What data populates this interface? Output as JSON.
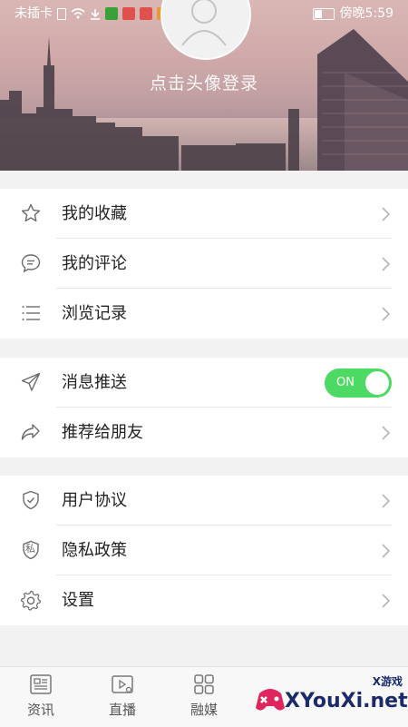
{
  "status": {
    "carrier": "未插卡",
    "time": "傍晚5:59"
  },
  "profile": {
    "login_prompt": "点击头像登录"
  },
  "menu": {
    "group1": [
      {
        "label": "我的收藏",
        "icon": "star-icon"
      },
      {
        "label": "我的评论",
        "icon": "comment-icon"
      },
      {
        "label": "浏览记录",
        "icon": "list-icon"
      }
    ],
    "group2": [
      {
        "label": "消息推送",
        "icon": "send-icon",
        "toggle": "ON"
      },
      {
        "label": "推荐给朋友",
        "icon": "share-icon"
      }
    ],
    "group3": [
      {
        "label": "用户协议",
        "icon": "shield-check-icon"
      },
      {
        "label": "隐私政策",
        "icon": "privacy-shield-icon",
        "icon_text": "私"
      },
      {
        "label": "设置",
        "icon": "gear-icon"
      }
    ]
  },
  "bottom_nav": [
    {
      "label": "资讯",
      "icon": "news-icon"
    },
    {
      "label": "直播",
      "icon": "live-icon"
    },
    {
      "label": "融媒",
      "icon": "grid-icon"
    }
  ],
  "watermark": {
    "brand": "XYouXi.net",
    "small": "X游戏"
  },
  "colors": {
    "toggle_on": "#4cd964",
    "text": "#222222",
    "icon": "#666666"
  }
}
